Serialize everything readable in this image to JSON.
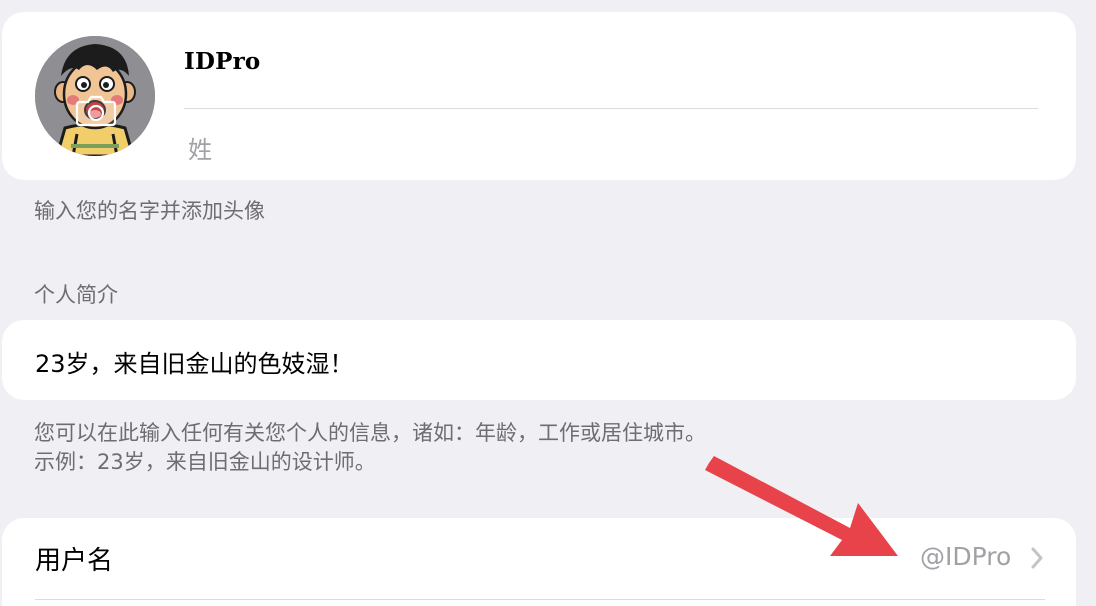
{
  "profile": {
    "first_name": "IDPro",
    "last_name_placeholder": "姓",
    "avatar_icon": "cartoon-avatar",
    "camera_icon": "camera-icon"
  },
  "profile_footer": "输入您的名字并添加头像",
  "bio": {
    "header": "个人简介",
    "text": "23岁，来自旧金山的色妓湿！",
    "footer_line1": "您可以在此输入任何有关您个人的信息，诸如：年龄，工作或居住城市。",
    "footer_line2": "示例：23岁，来自旧金山的设计师。"
  },
  "username": {
    "label": "用户名",
    "value": "@IDPro",
    "chevron_icon": "chevron-right-icon"
  },
  "colors": {
    "background": "#efeff4",
    "card": "#ffffff",
    "secondary_text": "#6d6d72",
    "placeholder_text": "#a1a1a6",
    "arrow": "#e8434a"
  }
}
